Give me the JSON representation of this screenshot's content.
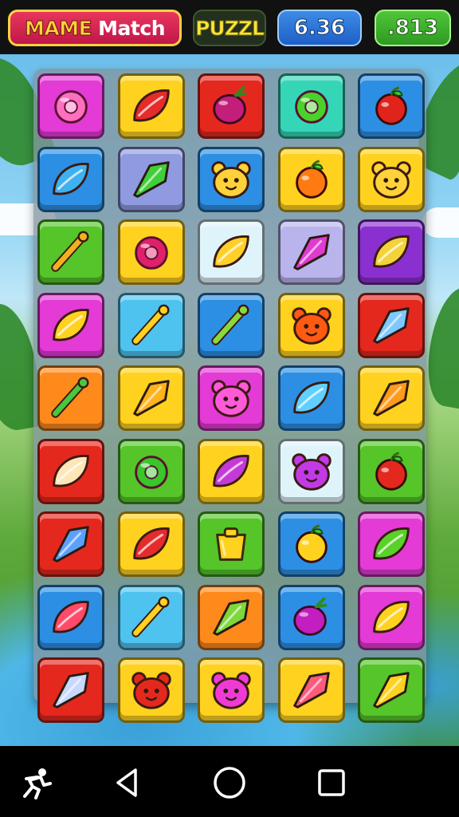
{
  "header": {
    "title_part1": "MAME",
    "title_part2": "Match",
    "logo_text": "PUZZL",
    "score": "6.36",
    "moves": ".813"
  },
  "colors": {
    "magenta": "#e43ad6",
    "yellow": "#ffd21f",
    "red": "#e5281e",
    "teal": "#35d6b8",
    "blue": "#2c8fe4",
    "lightblue": "#4fc3f0",
    "periwinkle": "#8f9ae0",
    "green": "#55c52a",
    "white": "#dff3fb",
    "lavender": "#b9b4ec",
    "purple": "#8a2fd0",
    "orange": "#ff8a1c"
  },
  "board": [
    [
      {
        "bg": "magenta",
        "icon": "ring",
        "fg": "#ff6fc0"
      },
      {
        "bg": "yellow",
        "icon": "leaf",
        "fg": "#e52b2b"
      },
      {
        "bg": "red",
        "icon": "berry",
        "fg": "#c21e7a"
      },
      {
        "bg": "teal",
        "icon": "ring",
        "fg": "#49d12d"
      },
      {
        "bg": "blue",
        "icon": "apple",
        "fg": "#e0241c"
      }
    ],
    [
      {
        "bg": "blue",
        "icon": "leaf",
        "fg": "#3fb0f0"
      },
      {
        "bg": "periwinkle",
        "icon": "arrow",
        "fg": "#3fcf3a"
      },
      {
        "bg": "blue",
        "icon": "bear",
        "fg": "#ffd23a"
      },
      {
        "bg": "yellow",
        "icon": "apple",
        "fg": "#ff7a10"
      },
      {
        "bg": "yellow",
        "icon": "bear",
        "fg": "#ffd23a"
      }
    ],
    [
      {
        "bg": "green",
        "icon": "wand",
        "fg": "#f0b020"
      },
      {
        "bg": "yellow",
        "icon": "ring",
        "fg": "#e0206a"
      },
      {
        "bg": "white",
        "icon": "leaf",
        "fg": "#ffd02a"
      },
      {
        "bg": "lavender",
        "icon": "arrow",
        "fg": "#e03ad0"
      },
      {
        "bg": "purple",
        "icon": "leaf",
        "fg": "#f4d23a"
      }
    ],
    [
      {
        "bg": "magenta",
        "icon": "leaf",
        "fg": "#ffd21f"
      },
      {
        "bg": "lightblue",
        "icon": "wand",
        "fg": "#ffd21f"
      },
      {
        "bg": "blue",
        "icon": "wand",
        "fg": "#8bd83a"
      },
      {
        "bg": "yellow",
        "icon": "bear",
        "fg": "#ff5a12"
      },
      {
        "bg": "red",
        "icon": "arrow",
        "fg": "#7ec8ff"
      }
    ],
    [
      {
        "bg": "orange",
        "icon": "wand",
        "fg": "#48c83a"
      },
      {
        "bg": "yellow",
        "icon": "arrow",
        "fg": "#ffb21a"
      },
      {
        "bg": "magenta",
        "icon": "bear",
        "fg": "#ff5ad8"
      },
      {
        "bg": "blue",
        "icon": "leaf",
        "fg": "#5fd0ff"
      },
      {
        "bg": "yellow",
        "icon": "arrow",
        "fg": "#ff9a1a"
      }
    ],
    [
      {
        "bg": "red",
        "icon": "leaf",
        "fg": "#ffe6b8"
      },
      {
        "bg": "green",
        "icon": "ring",
        "fg": "#39c62a"
      },
      {
        "bg": "yellow",
        "icon": "leaf",
        "fg": "#c43ad6"
      },
      {
        "bg": "white",
        "icon": "bear",
        "fg": "#c23ae6"
      },
      {
        "bg": "green",
        "icon": "apple",
        "fg": "#e5281e"
      }
    ],
    [
      {
        "bg": "red",
        "icon": "arrow",
        "fg": "#5aa0ff"
      },
      {
        "bg": "yellow",
        "icon": "leaf",
        "fg": "#e52b2b"
      },
      {
        "bg": "green",
        "icon": "cup",
        "fg": "#ffd21f"
      },
      {
        "bg": "blue",
        "icon": "apple",
        "fg": "#ffd21f"
      },
      {
        "bg": "magenta",
        "icon": "leaf",
        "fg": "#5ad02a"
      }
    ],
    [
      {
        "bg": "blue",
        "icon": "leaf",
        "fg": "#ff4a6a"
      },
      {
        "bg": "lightblue",
        "icon": "wand",
        "fg": "#ffd21f"
      },
      {
        "bg": "orange",
        "icon": "arrow",
        "fg": "#7ed83a"
      },
      {
        "bg": "blue",
        "icon": "berry",
        "fg": "#c21ec0"
      },
      {
        "bg": "magenta",
        "icon": "leaf",
        "fg": "#ffd21f"
      }
    ],
    [
      {
        "bg": "red",
        "icon": "arrow",
        "fg": "#c8d8ff"
      },
      {
        "bg": "yellow",
        "icon": "bear",
        "fg": "#e5281e"
      },
      {
        "bg": "yellow",
        "icon": "bear",
        "fg": "#f03ad6"
      },
      {
        "bg": "yellow",
        "icon": "arrow",
        "fg": "#ff5a7a"
      },
      {
        "bg": "green",
        "icon": "arrow",
        "fg": "#ffd21f"
      }
    ]
  ],
  "navbar": {
    "items": [
      "app-icon",
      "back-icon",
      "home-icon",
      "recents-icon"
    ]
  }
}
